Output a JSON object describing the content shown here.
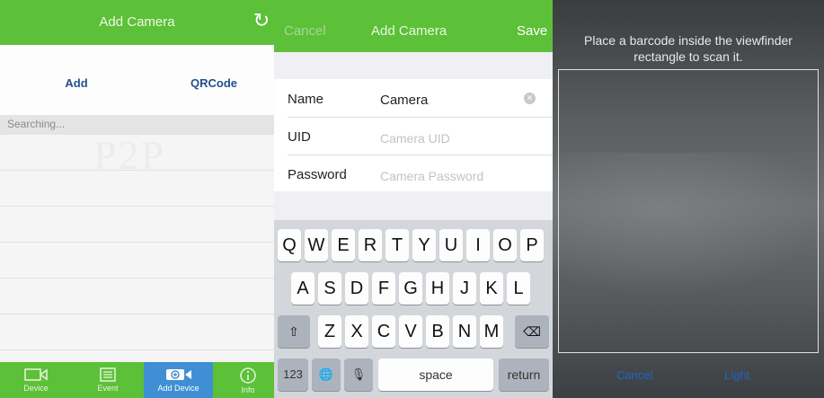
{
  "panel1": {
    "title": "Add Camera",
    "refresh_icon": "refresh-icon",
    "tabs": {
      "add": "Add",
      "qrcode": "QRCode"
    },
    "search_status": "Searching...",
    "watermark": "P2P",
    "tabbar": [
      {
        "label": "Device",
        "icon": "camera-icon"
      },
      {
        "label": "Event",
        "icon": "list-icon"
      },
      {
        "label": "Add Device",
        "icon": "add-device-icon",
        "active": true
      },
      {
        "label": "Info",
        "icon": "info-icon"
      }
    ],
    "accent_color": "#5cc038",
    "active_tab_color": "#3f8fd4"
  },
  "panel2": {
    "nav": {
      "cancel": "Cancel",
      "title": "Add Camera",
      "save": "Save"
    },
    "fields": [
      {
        "label": "Name",
        "value": "Camera",
        "placeholder": ""
      },
      {
        "label": "UID",
        "value": "",
        "placeholder": "Camera UID"
      },
      {
        "label": "Password",
        "value": "",
        "placeholder": "Camera Password"
      }
    ],
    "clear_icon": "clear-field-icon",
    "keyboard": {
      "row1": [
        "Q",
        "W",
        "E",
        "R",
        "T",
        "Y",
        "U",
        "I",
        "O",
        "P"
      ],
      "row2": [
        "A",
        "S",
        "D",
        "F",
        "G",
        "H",
        "J",
        "K",
        "L"
      ],
      "row3": [
        "Z",
        "X",
        "C",
        "V",
        "B",
        "N",
        "M"
      ],
      "shift": "⇧",
      "backspace": "⌫",
      "numbers": "123",
      "globe": "🌐",
      "mic": "🎙",
      "space": "space",
      "return": "return"
    }
  },
  "panel3": {
    "instruction": "Place a barcode inside the viewfinder rectangle to scan it.",
    "cancel": "Cancel",
    "light": "Light"
  }
}
